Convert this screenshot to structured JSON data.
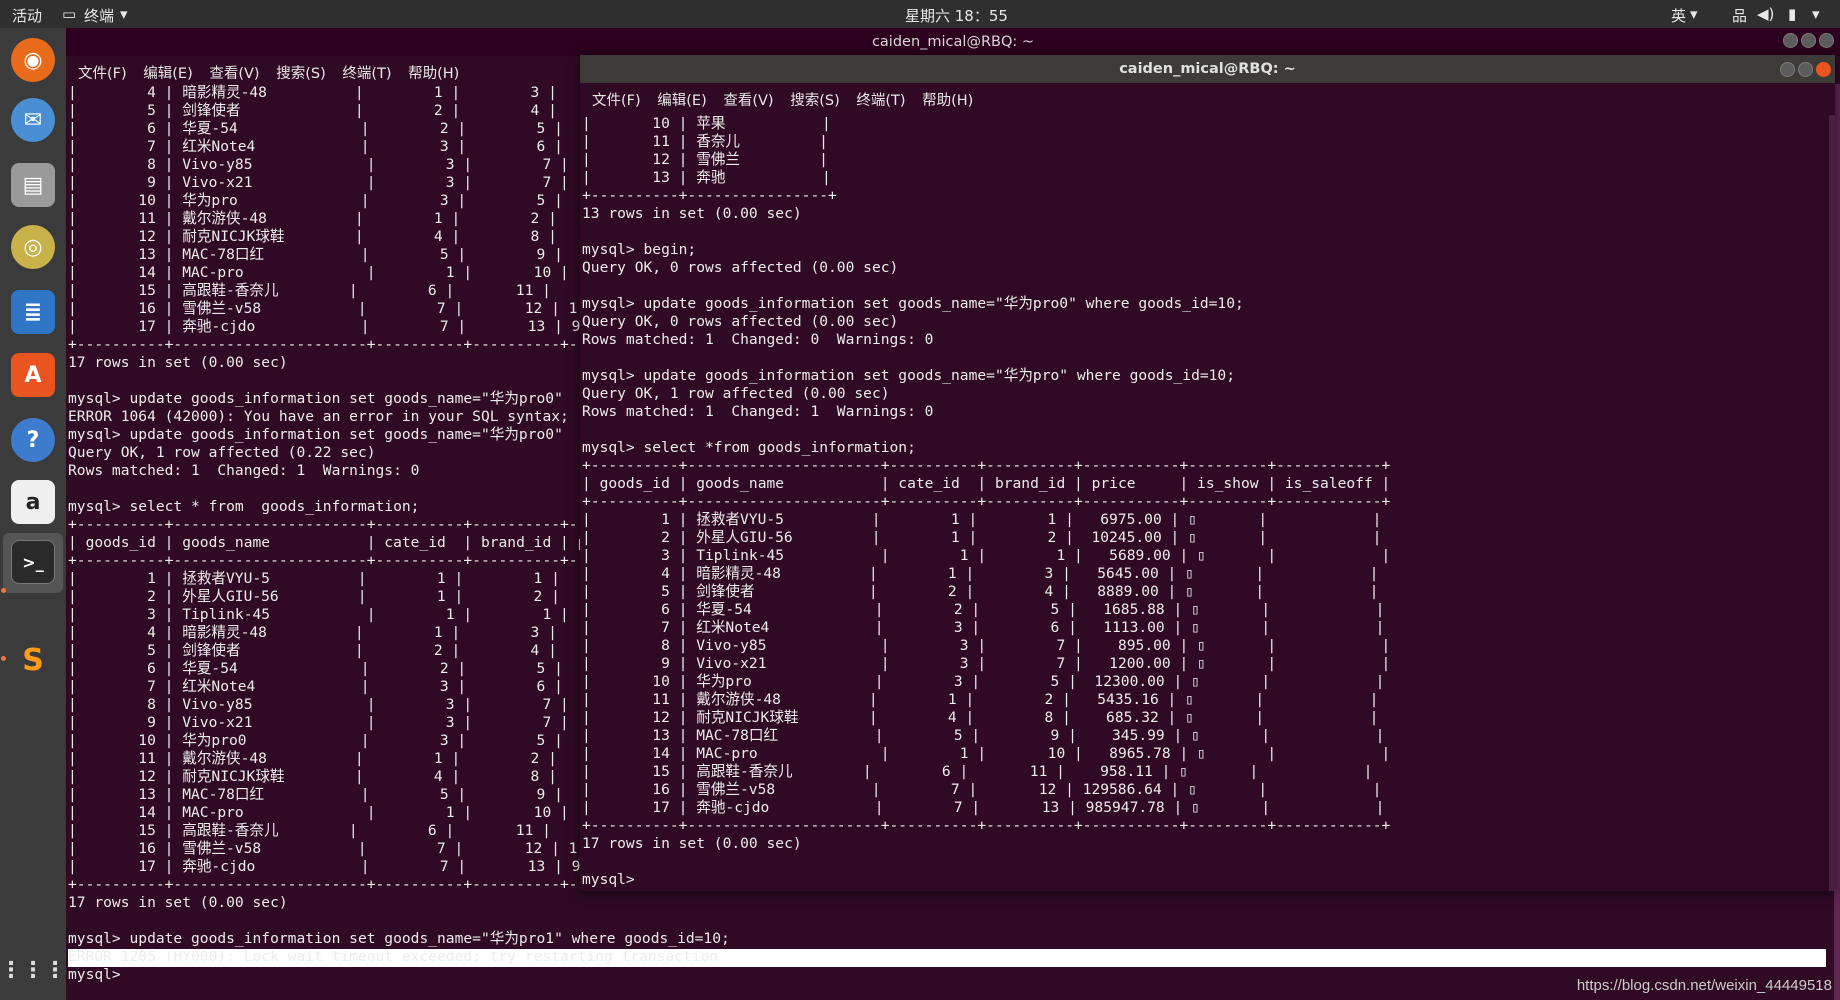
{
  "topbar": {
    "activities": "活动",
    "app": "终端",
    "clock": "星期六 18：55",
    "lang": "英"
  },
  "back_window": {
    "title": "caiden_mical@RBQ: ~",
    "menu": [
      "文件(F)",
      "编辑(E)",
      "查看(V)",
      "搜索(S)",
      "终端(T)",
      "帮助(H)"
    ],
    "content": "|        4 | 暗影精灵-48          |        1 |        3 |\n|        5 | 剑锋使者             |        2 |        4 |\n|        6 | 华夏-54              |        2 |        5 |\n|        7 | 红米Note4            |        3 |        6 |\n|        8 | Vivo-y85             |        3 |        7 |\n|        9 | Vivo-x21             |        3 |        7 |\n|       10 | 华为pro              |        3 |        5 |\n|       11 | 戴尔游侠-48          |        1 |        2 |\n|       12 | 耐克NICJK球鞋        |        4 |        8 |\n|       13 | MAC-78口红           |        5 |        9 |\n|       14 | MAC-pro              |        1 |       10 |\n|       15 | 高跟鞋-香奈儿        |        6 |       11 |\n|       16 | 雪佛兰-v58           |        7 |       12 | 1\n|       17 | 奔驰-cjdo            |        7 |       13 | 9\n+----------+----------------------+----------+----------+-\n17 rows in set (0.00 sec)\n\nmysql> update goods_information set goods_name=\"华为pro0\"\nERROR 1064 (42000): You have an error in your SQL syntax;\nmysql> update goods_information set goods_name=\"华为pro0\"\nQuery OK, 1 row affected (0.22 sec)\nRows matched: 1  Changed: 1  Warnings: 0\n\nmysql> select * from  goods_information;\n+----------+----------------------+----------+----------+-\n| goods_id | goods_name           | cate_id  | brand_id | p\n+----------+----------------------+----------+----------+-\n|        1 | 拯救者VYU-5          |        1 |        1 |\n|        2 | 外星人GIU-56         |        1 |        2 |\n|        3 | Tiplink-45           |        1 |        1 |\n|        4 | 暗影精灵-48          |        1 |        3 |\n|        5 | 剑锋使者             |        2 |        4 |\n|        6 | 华夏-54              |        2 |        5 |\n|        7 | 红米Note4            |        3 |        6 |\n|        8 | Vivo-y85             |        3 |        7 |\n|        9 | Vivo-x21             |        3 |        7 |\n|       10 | 华为pro0             |        3 |        5 |\n|       11 | 戴尔游侠-48          |        1 |        2 |\n|       12 | 耐克NICJK球鞋        |        4 |        8 |\n|       13 | MAC-78口红           |        5 |        9 |\n|       14 | MAC-pro              |        1 |       10 |\n|       15 | 高跟鞋-香奈儿        |        6 |       11 |\n|       16 | 雪佛兰-v58           |        7 |       12 | 1\n|       17 | 奔驰-cjdo            |        7 |       13 | 9\n+----------+----------------------+----------+----------+-\n17 rows in set (0.00 sec)\n\nmysql> update goods_information set goods_name=\"华为pro1\" where goods_id=10;\nERROR 1205 (HY000): Lock wait timeout exceeded; try restarting transaction\nmysql> "
  },
  "front_window": {
    "title": "caiden_mical@RBQ: ~",
    "menu": [
      "文件(F)",
      "编辑(E)",
      "查看(V)",
      "搜索(S)",
      "终端(T)",
      "帮助(H)"
    ],
    "content": "|       10 | 苹果           |\n|       11 | 香奈儿         |\n|       12 | 雪佛兰         |\n|       13 | 奔驰           |\n+----------+----------------+\n13 rows in set (0.00 sec)\n\nmysql> begin;\nQuery OK, 0 rows affected (0.00 sec)\n\nmysql> update goods_information set goods_name=\"华为pro0\" where goods_id=10;\nQuery OK, 0 rows affected (0.00 sec)\nRows matched: 1  Changed: 0  Warnings: 0\n\nmysql> update goods_information set goods_name=\"华为pro\" where goods_id=10;\nQuery OK, 1 row affected (0.00 sec)\nRows matched: 1  Changed: 1  Warnings: 0\n\nmysql> select *from goods_information;\n+----------+----------------------+----------+----------+-----------+---------+------------+\n| goods_id | goods_name           | cate_id  | brand_id | price     | is_show | is_saleoff |\n+----------+----------------------+----------+----------+-----------+---------+------------+\n|        1 | 拯救者VYU-5          |        1 |        1 |   6975.00 | ▯       |            |\n|        2 | 外星人GIU-56         |        1 |        2 |  10245.00 | ▯       |            |\n|        3 | Tiplink-45           |        1 |        1 |   5689.00 | ▯       |            |\n|        4 | 暗影精灵-48          |        1 |        3 |   5645.00 | ▯       |            |\n|        5 | 剑锋使者             |        2 |        4 |   8889.00 | ▯       |            |\n|        6 | 华夏-54              |        2 |        5 |   1685.88 | ▯       |            |\n|        7 | 红米Note4            |        3 |        6 |   1113.00 | ▯       |            |\n|        8 | Vivo-y85             |        3 |        7 |    895.00 | ▯       |            |\n|        9 | Vivo-x21             |        3 |        7 |   1200.00 | ▯       |            |\n|       10 | 华为pro              |        3 |        5 |  12300.00 | ▯       |            |\n|       11 | 戴尔游侠-48          |        1 |        2 |   5435.16 | ▯       |            |\n|       12 | 耐克NICJK球鞋        |        4 |        8 |    685.32 | ▯       |            |\n|       13 | MAC-78口红           |        5 |        9 |    345.99 | ▯       |            |\n|       14 | MAC-pro              |        1 |       10 |   8965.78 | ▯       |            |\n|       15 | 高跟鞋-香奈儿        |        6 |       11 |    958.11 | ▯       |            |\n|       16 | 雪佛兰-v58           |        7 |       12 | 129586.64 | ▯       |            |\n|       17 | 奔驰-cjdo            |        7 |       13 | 985947.78 | ▯       |            |\n+----------+----------------------+----------+----------+-----------+---------+------------+\n17 rows in set (0.00 sec)\n\nmysql> "
  },
  "watermark": "https://blog.csdn.net/weixin_44449518"
}
